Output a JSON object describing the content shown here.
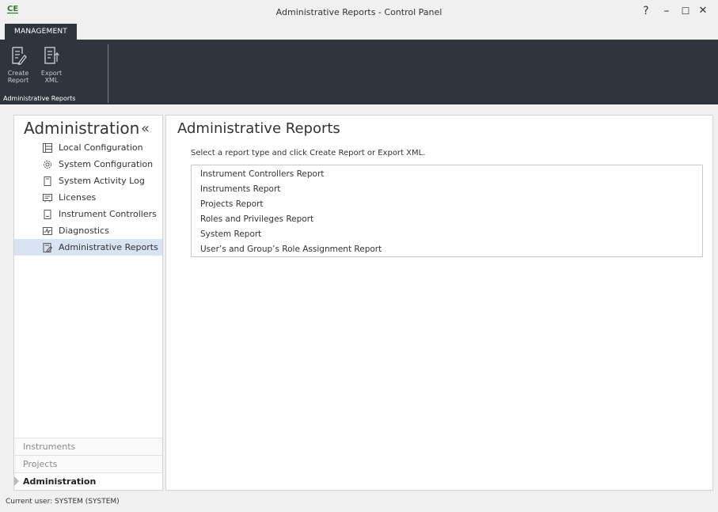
{
  "window": {
    "logo_text": "CE",
    "title": "Administrative Reports - Control Panel",
    "controls": {
      "help": "?",
      "minimize": "–",
      "maximize": "☐",
      "close": "✕"
    }
  },
  "ribbon": {
    "tab_label": "MANAGEMENT",
    "buttons": [
      {
        "line1": "Create",
        "line2": "Report",
        "icon": "create-report-icon"
      },
      {
        "line1": "Export",
        "line2": "XML",
        "icon": "export-xml-icon"
      }
    ],
    "group_label": "Administrative Reports"
  },
  "sidebar": {
    "title": "Administration",
    "collapse_glyph": "«",
    "items": [
      {
        "label": "Local Configuration",
        "icon": "local-configuration-icon"
      },
      {
        "label": "System Configuration",
        "icon": "system-configuration-icon"
      },
      {
        "label": "System Activity Log",
        "icon": "system-activity-log-icon"
      },
      {
        "label": "Licenses",
        "icon": "licenses-icon"
      },
      {
        "label": "Instrument Controllers",
        "icon": "instrument-controllers-icon"
      },
      {
        "label": "Diagnostics",
        "icon": "diagnostics-icon"
      },
      {
        "label": "Administrative Reports",
        "icon": "administrative-reports-icon",
        "selected": true
      }
    ],
    "bottom_nav": [
      {
        "label": "Instruments"
      },
      {
        "label": "Projects"
      },
      {
        "label": "Administration",
        "active": true
      }
    ]
  },
  "main": {
    "title": "Administrative Reports",
    "instruction": "Select a report type and click Create Report or Export XML.",
    "reports": [
      "Instrument Controllers Report",
      "Instruments Report",
      "Projects Report",
      "Roles and Privileges Report",
      "System Report",
      "User’s and Group’s Role Assignment Report"
    ]
  },
  "status": {
    "text": "Current user: SYSTEM (SYSTEM)"
  },
  "colors": {
    "ribbon_bg": "#2e353d",
    "selected_bg": "#d8e4f3",
    "logo": "#2e7d32"
  }
}
